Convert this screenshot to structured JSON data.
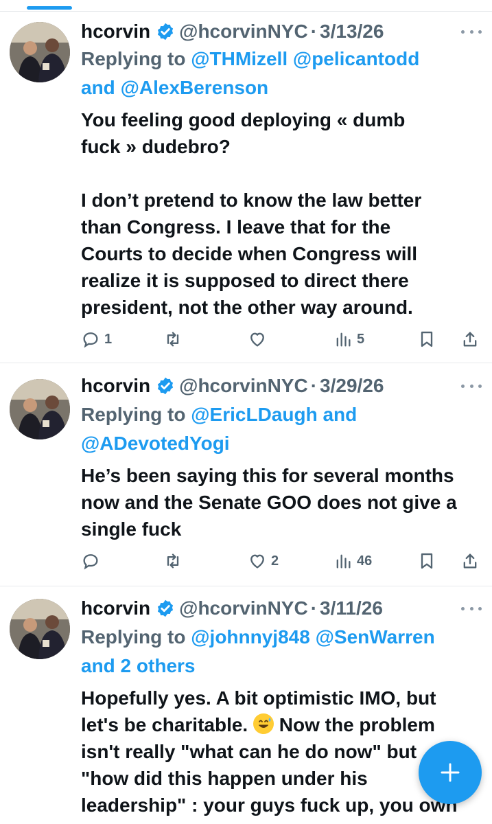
{
  "colors": {
    "accent": "#1d9bf0",
    "muted": "#536471",
    "text": "#0f1419"
  },
  "tweets": [
    {
      "name": "hcorvin",
      "handle": "@hcorvinNYC",
      "dot": "·",
      "date": "3/13/26",
      "replying_prefix": "Replying to ",
      "replying_links": [
        "@THMizell",
        "@pelicantodd"
      ],
      "replying_and": "and",
      "replying_last": "@AlexBerenson",
      "body": "You feeling good deploying « dumb\nfuck » dudebro?\n\nI don’t pretend to know the law better\nthan Congress. I leave that for the\nCourts to decide when Congress will\nrealize it is supposed to direct there\npresident, not the other way around.",
      "actions": {
        "replies": "1",
        "retweets": "",
        "likes": "",
        "views": "5"
      }
    },
    {
      "name": "hcorvin",
      "handle": "@hcorvinNYC",
      "dot": "·",
      "date": "3/29/26",
      "replying_prefix": "Replying to ",
      "replying_links": [
        "@EricLDaugh"
      ],
      "replying_and": "and",
      "replying_last": "@ADevotedYogi",
      "body": "He’s been saying this for several months\nnow and the Senate GOO does not give a\nsingle fuck",
      "actions": {
        "replies": "",
        "retweets": "",
        "likes": "2",
        "views": "46"
      }
    },
    {
      "name": "hcorvin",
      "handle": "@hcorvinNYC",
      "dot": "·",
      "date": "3/11/26",
      "replying_prefix": "Replying to ",
      "replying_links": [
        "@johnnyj848",
        "@SenWarren"
      ],
      "replying_and": "",
      "replying_last": "and 2 others",
      "body_line1": "Hopefully yes. A bit optimistic IMO, but",
      "body_line2": "let's be charitable.",
      "body_line2b": " Now the problem",
      "body_rest": "isn't really \"what can he do now\" but\n\"how did this happen under his\nleadership\" : your guys fuck up, you own",
      "emoji_icon": "grinning-sweat-emoji"
    }
  ],
  "fab": {
    "icon": "plus-icon"
  }
}
